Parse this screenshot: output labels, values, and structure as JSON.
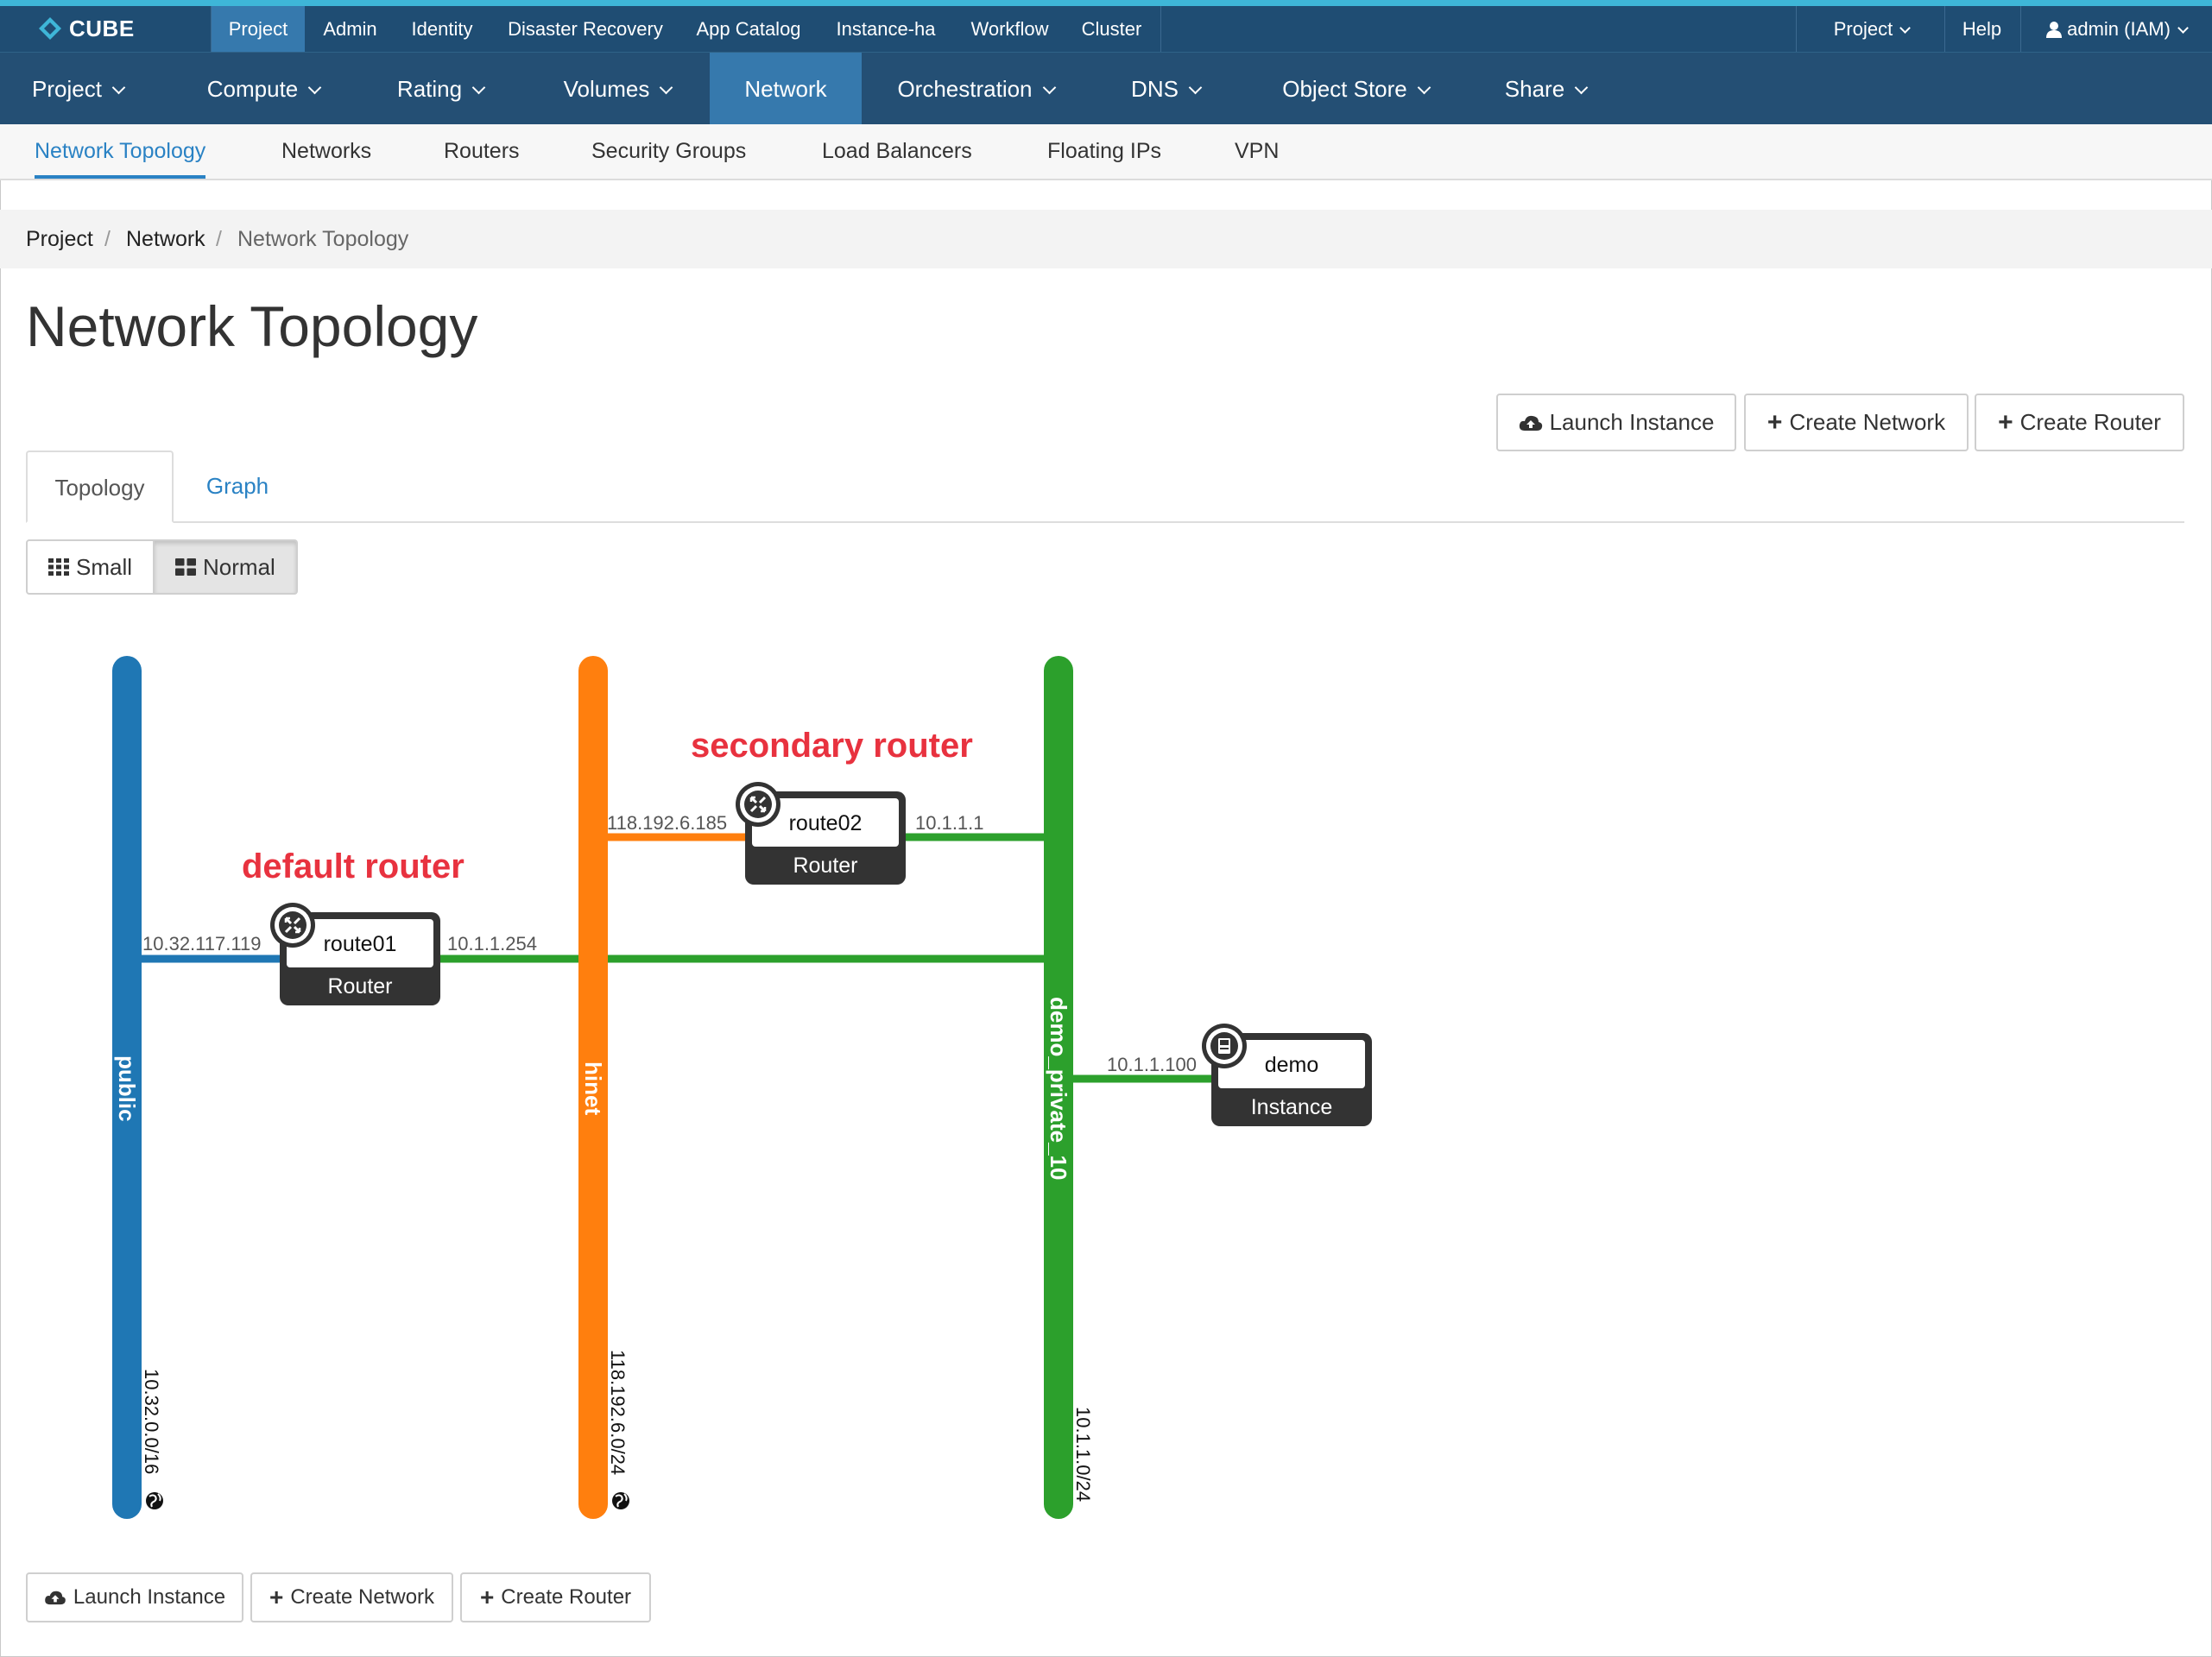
{
  "brand": {
    "name": "CUBE"
  },
  "top_nav": {
    "items": [
      "Project",
      "Admin",
      "Identity",
      "Disaster Recovery",
      "App Catalog",
      "Instance-ha",
      "Workflow",
      "Cluster"
    ],
    "right": {
      "project": "Project",
      "help": "Help",
      "user": "admin (IAM)"
    }
  },
  "main_nav": [
    "Project",
    "Compute",
    "Rating",
    "Volumes",
    "Network",
    "Orchestration",
    "DNS",
    "Object Store",
    "Share"
  ],
  "sub_nav": [
    "Network Topology",
    "Networks",
    "Routers",
    "Security Groups",
    "Load Balancers",
    "Floating IPs",
    "VPN"
  ],
  "breadcrumb": [
    "Project",
    "Network",
    "Network Topology"
  ],
  "page_title": "Network Topology",
  "actions": {
    "launch_instance": "Launch Instance",
    "create_network": "Create Network",
    "create_router": "Create Router"
  },
  "tabs": [
    "Topology",
    "Graph"
  ],
  "view_toggle": {
    "small": "Small",
    "normal": "Normal",
    "selected": "Normal"
  },
  "topology": {
    "networks": [
      {
        "name": "public",
        "cidr": "10.32.0.0/16",
        "color": "#1f77b4",
        "external": true
      },
      {
        "name": "hinet",
        "cidr": "118.192.6.0/24",
        "color": "#ff7f0e",
        "external": true
      },
      {
        "name": "demo_private_10",
        "cidr": "10.1.1.0/24",
        "color": "#2ca02c",
        "external": false
      }
    ],
    "devices": [
      {
        "name": "route01",
        "type": "Router",
        "annotation": "default router",
        "left_ip": "10.32.117.119",
        "right_ip": "10.1.1.254"
      },
      {
        "name": "route02",
        "type": "Router",
        "annotation": "secondary router",
        "left_ip": "118.192.6.185",
        "right_ip": "10.1.1.1"
      },
      {
        "name": "demo",
        "type": "Instance",
        "left_ip": "10.1.1.100"
      }
    ]
  },
  "colors": {
    "accent": "#3eb6d8",
    "nav_bg": "#244f74",
    "nav_active": "#3679ad",
    "link": "#2a82c4",
    "annotation": "#e8323f"
  }
}
